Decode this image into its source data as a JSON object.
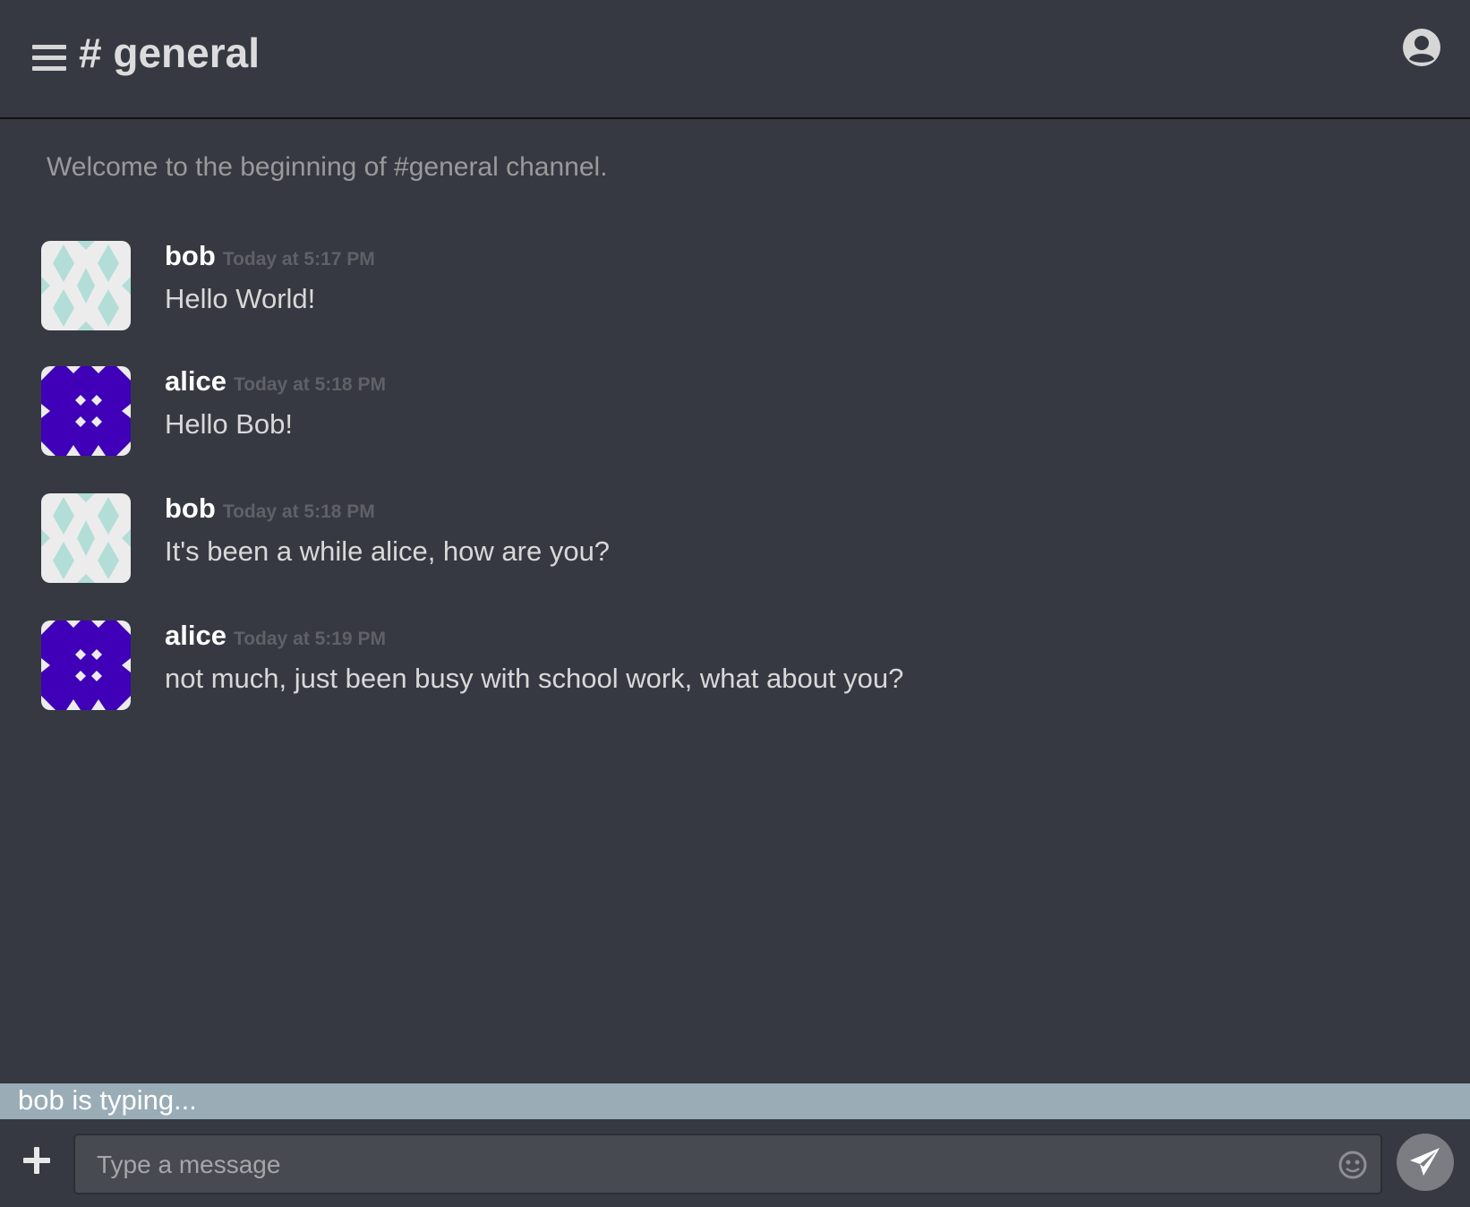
{
  "header": {
    "channel_title": "# general",
    "menu_icon": "hamburger-menu-icon",
    "user_icon": "user-account-icon"
  },
  "welcome_text": "Welcome to the beginning of #general channel.",
  "messages": [
    {
      "author": "bob",
      "timestamp": "Today at 5:17 PM",
      "text": "Hello World!",
      "avatar": "identicon-mint"
    },
    {
      "author": "alice",
      "timestamp": "Today at 5:18 PM",
      "text": "Hello Bob!",
      "avatar": "identicon-purple"
    },
    {
      "author": "bob",
      "timestamp": "Today at 5:18 PM",
      "text": "It's been a while alice, how are you?",
      "avatar": "identicon-mint"
    },
    {
      "author": "alice",
      "timestamp": "Today at 5:19 PM",
      "text": "not much, just been busy with school work, what about you?",
      "avatar": "identicon-purple"
    }
  ],
  "typing_indicator": "bob is typing...",
  "composer": {
    "placeholder": "Type a message",
    "value": "",
    "add_icon": "plus-icon",
    "emoji_icon": "emoji-icon",
    "send_icon": "paper-plane-icon"
  },
  "colors": {
    "background": "#363941",
    "typing_bar": "#9aadb6",
    "bob_avatar": "#b3ded8",
    "alice_avatar": "#3f00b8"
  }
}
